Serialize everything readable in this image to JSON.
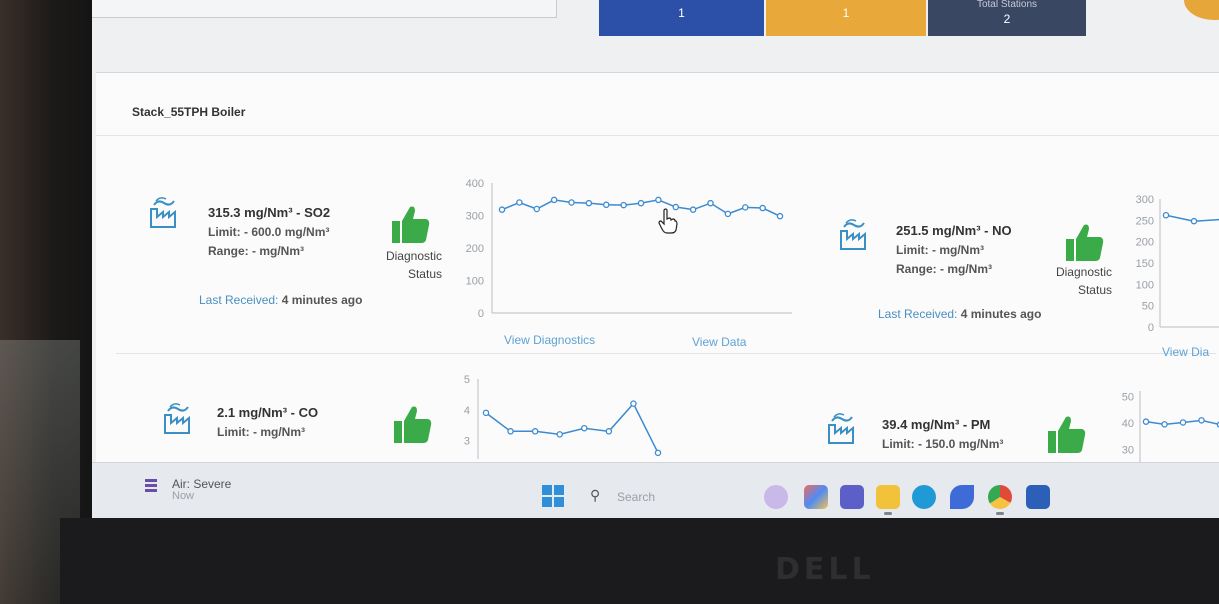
{
  "header": {
    "stat_boxes": [
      {
        "label": "",
        "value": "1",
        "color": "#2c50a8"
      },
      {
        "label": "",
        "value": "1",
        "color": "#e9a93a"
      },
      {
        "label": "Total Stations",
        "value": "2",
        "color": "#3a4763"
      }
    ]
  },
  "panel": {
    "title": "Stack_55TPH Boiler"
  },
  "parameters": [
    {
      "reading": "315.3 mg/Nm³ - SO2",
      "limit": "Limit:  - 600.0  mg/Nm³",
      "range": "Range:  -  mg/Nm³",
      "diagnostic_label_1": "Diagnostic",
      "diagnostic_label_2": "Status",
      "last_received_label": "Last Received:",
      "last_received_value": "4 minutes ago",
      "view_diagnostics": "View Diagnostics",
      "view_data": "View Data"
    },
    {
      "reading": "251.5 mg/Nm³ - NO",
      "limit": "Limit:  -  mg/Nm³",
      "range": "Range:  -  mg/Nm³",
      "diagnostic_label_1": "Diagnostic",
      "diagnostic_label_2": "Status",
      "last_received_label": "Last Received:",
      "last_received_value": "4 minutes ago",
      "view_diagnostics": "View Dia"
    },
    {
      "reading": "2.1 mg/Nm³ - CO",
      "limit": "Limit:  -  mg/Nm³"
    },
    {
      "reading": "39.4 mg/Nm³ - PM",
      "limit": "Limit:  - 150.0  mg/Nm³"
    }
  ],
  "chart_data": [
    {
      "type": "line",
      "series_of": "SO2",
      "y_ticks": [
        "400",
        "300",
        "200",
        "100",
        "0"
      ],
      "ylim": [
        0,
        400
      ],
      "values": [
        318,
        340,
        320,
        348,
        340,
        338,
        333,
        332,
        338,
        348,
        326,
        318,
        338,
        305,
        325,
        323,
        298
      ],
      "color": "#3c8ad0"
    },
    {
      "type": "line",
      "series_of": "NO",
      "y_ticks": [
        "300",
        "250",
        "200",
        "150",
        "100",
        "50",
        "0"
      ],
      "ylim": [
        0,
        300
      ],
      "values": [
        262,
        248,
        252
      ],
      "color": "#3c8ad0"
    },
    {
      "type": "line",
      "series_of": "CO",
      "y_ticks": [
        "5",
        "4",
        "3"
      ],
      "ylim": [
        2.4,
        5
      ],
      "values": [
        3.9,
        3.3,
        3.3,
        3.2,
        3.4,
        3.3,
        4.2,
        2.6
      ],
      "color": "#3c8ad0"
    },
    {
      "type": "line",
      "series_of": "PM",
      "y_ticks": [
        "50",
        "40",
        "30"
      ],
      "ylim": [
        25,
        52
      ],
      "values": [
        40.5,
        39.5,
        40.2,
        41.0,
        39.4
      ],
      "color": "#3c8ad0"
    }
  ],
  "taskbar": {
    "weather_title": "Air: Severe",
    "weather_sub": "Now",
    "search_placeholder": "Search"
  }
}
